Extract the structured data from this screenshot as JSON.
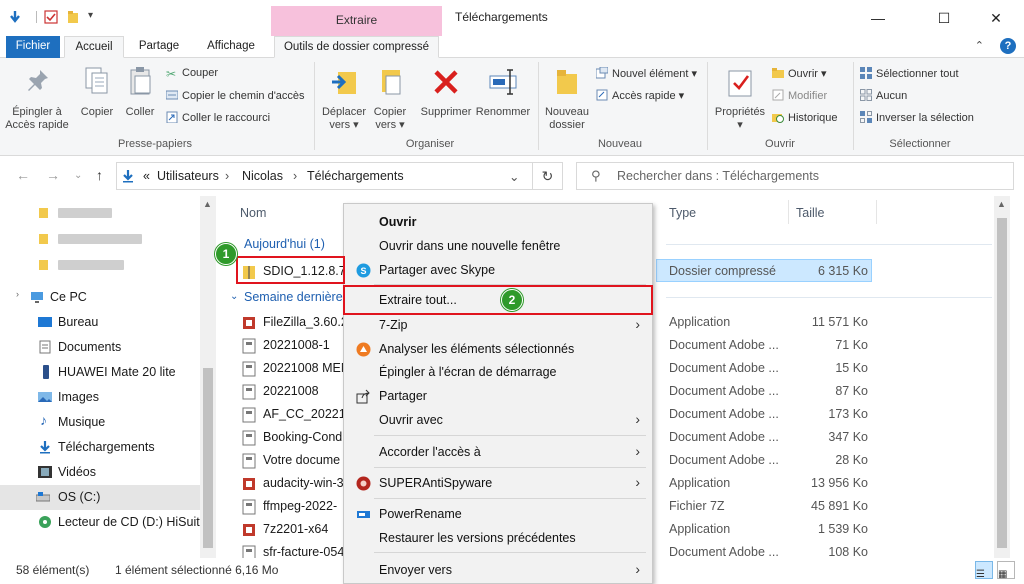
{
  "titlebar": {
    "contextual_tab": "Extraire",
    "window_title": "Téléchargements",
    "minimize_icon": "minimize-icon",
    "maximize_icon": "maximize-icon",
    "close_icon": "close-icon"
  },
  "tabs": {
    "file": "Fichier",
    "home": "Accueil",
    "share": "Partage",
    "view": "Affichage",
    "compressed_tools": "Outils de dossier compressé"
  },
  "ribbon": {
    "clipboard": {
      "pin": "Épingler à\nAccès rapide",
      "copy": "Copier",
      "paste": "Coller",
      "cut": "Couper",
      "copy_path": "Copier le chemin d'accès",
      "paste_shortcut": "Coller le raccourci",
      "group": "Presse-papiers"
    },
    "organize": {
      "move_to": "Déplacer\nvers ▾",
      "copy_to": "Copier\nvers ▾",
      "delete": "Supprimer",
      "rename": "Renommer",
      "group": "Organiser"
    },
    "new": {
      "new_folder": "Nouveau\ndossier",
      "new_item": "Nouvel élément ▾",
      "quick_access": "Accès rapide ▾",
      "group": "Nouveau"
    },
    "open": {
      "properties": "Propriétés",
      "open": "Ouvrir ▾",
      "edit": "Modifier",
      "history": "Historique",
      "group": "Ouvrir"
    },
    "select": {
      "select_all": "Sélectionner tout",
      "select_none": "Aucun",
      "invert": "Inverser la sélection",
      "group": "Sélectionner"
    }
  },
  "address": {
    "prefix": "«",
    "crumbs": [
      "Utilisateurs",
      "Nicolas",
      "Téléchargements"
    ],
    "search_placeholder": "Rechercher dans : Téléchargements"
  },
  "nav": {
    "items": [
      "Ce PC",
      "Bureau",
      "Documents",
      "HUAWEI Mate 20 lite",
      "Images",
      "Musique",
      "Téléchargements",
      "Vidéos",
      "OS (C:)",
      "Lecteur de CD (D:) HiSuite"
    ]
  },
  "columns": {
    "name": "Nom",
    "type": "Type",
    "size": "Taille"
  },
  "groups": {
    "today": "Aujourd'hui (1)",
    "last_week": "Semaine dernière"
  },
  "files": [
    {
      "name": "SDIO_1.12.8.749",
      "type": "Dossier compressé",
      "size": "6 315 Ko"
    },
    {
      "name": "FileZilla_3.60.2",
      "type": "Application",
      "size": "11 571 Ko"
    },
    {
      "name": "20221008-1",
      "type": "Document Adobe ...",
      "size": "71 Ko"
    },
    {
      "name": "20221008 MEN",
      "type": "Document Adobe ...",
      "size": "15 Ko"
    },
    {
      "name": "20221008",
      "type": "Document Adobe ...",
      "size": "87 Ko"
    },
    {
      "name": "AF_CC_202210",
      "type": "Document Adobe ...",
      "size": "173 Ko"
    },
    {
      "name": "Booking-Cond",
      "type": "Document Adobe ...",
      "size": "347 Ko"
    },
    {
      "name": "Votre docume",
      "type": "Document Adobe ...",
      "size": "28 Ko"
    },
    {
      "name": "audacity-win-3",
      "type": "Application",
      "size": "13 956 Ko"
    },
    {
      "name": "ffmpeg-2022-",
      "type": "Fichier 7Z",
      "size": "45 891 Ko"
    },
    {
      "name": "7z2201-x64",
      "type": "Application",
      "size": "1 539 Ko"
    },
    {
      "name": "sfr-facture-054",
      "type": "Document Adobe ...",
      "size": "108 Ko"
    }
  ],
  "status": {
    "count": "58 élément(s)",
    "selection": "1 élément sélectionné  6,16 Mo"
  },
  "menu": {
    "open": "Ouvrir",
    "open_new_window": "Ouvrir dans une nouvelle fenêtre",
    "skype": "Partager avec Skype",
    "extract_all": "Extraire tout...",
    "zip7": "7-Zip",
    "analyze": "Analyser les éléments sélectionnés",
    "pin_start": "Épingler à l'écran de démarrage",
    "share": "Partager",
    "open_with": "Ouvrir avec",
    "grant_access": "Accorder l'accès à",
    "superantispyware": "SUPERAntiSpyware",
    "powerrename": "PowerRename",
    "restore_versions": "Restaurer les versions précédentes",
    "send_to": "Envoyer vers"
  },
  "badges": {
    "one": "1",
    "two": "2"
  },
  "colors": {
    "accent": "#1e6fbf",
    "contextual": "#f7c1dc",
    "callout_red": "#e0141e",
    "badge_green": "#2f9a2a",
    "selection": "#cce8ff"
  }
}
